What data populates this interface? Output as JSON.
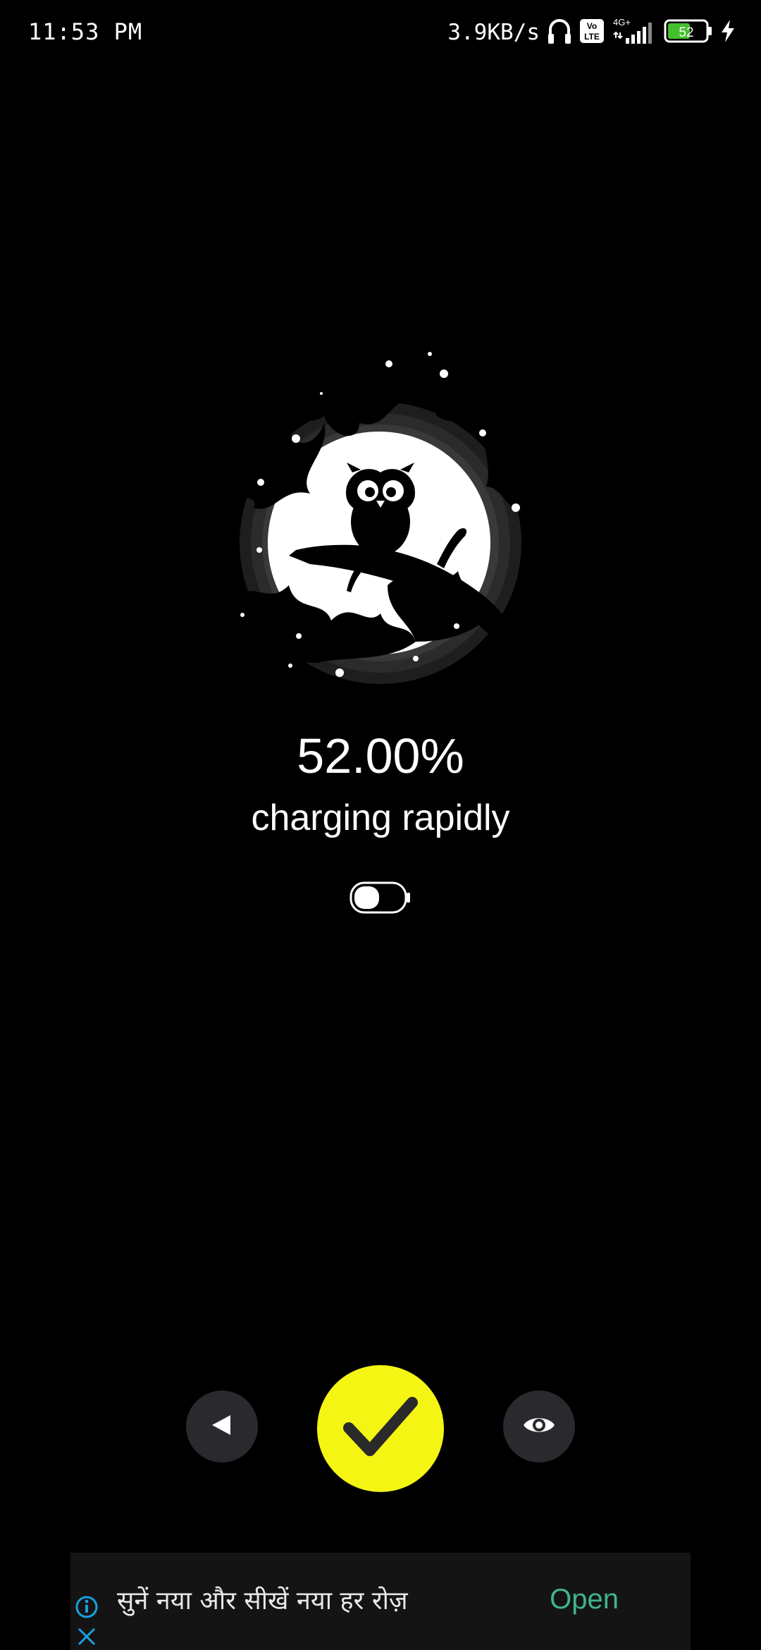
{
  "status_bar": {
    "time": "11:53 PM",
    "net_speed": "3.9KB/s",
    "network_type": "4G+",
    "volte_top": "Vo",
    "volte_bottom": "LTE",
    "battery_level": "52",
    "icons": [
      "headphones-icon",
      "volte-icon",
      "signal-icon",
      "battery-icon",
      "charging-bolt-icon"
    ]
  },
  "charge": {
    "percent": "52.00%",
    "status": "charging rapidly",
    "level": 0.52
  },
  "buttons": {
    "back_icon": "play-back-icon",
    "confirm_icon": "checkmark-icon",
    "preview_icon": "eye-icon"
  },
  "ad": {
    "text": "सुनें नया और सीखें नया हर रोज़",
    "cta": "Open",
    "info_icon": "info-icon",
    "close_icon": "close-icon"
  },
  "colors": {
    "background": "#000000",
    "accent_yellow": "#f5f514",
    "button_dark": "#2a2a2e",
    "ad_cta_green": "#3fb58b",
    "battery_green": "#43c02b"
  }
}
